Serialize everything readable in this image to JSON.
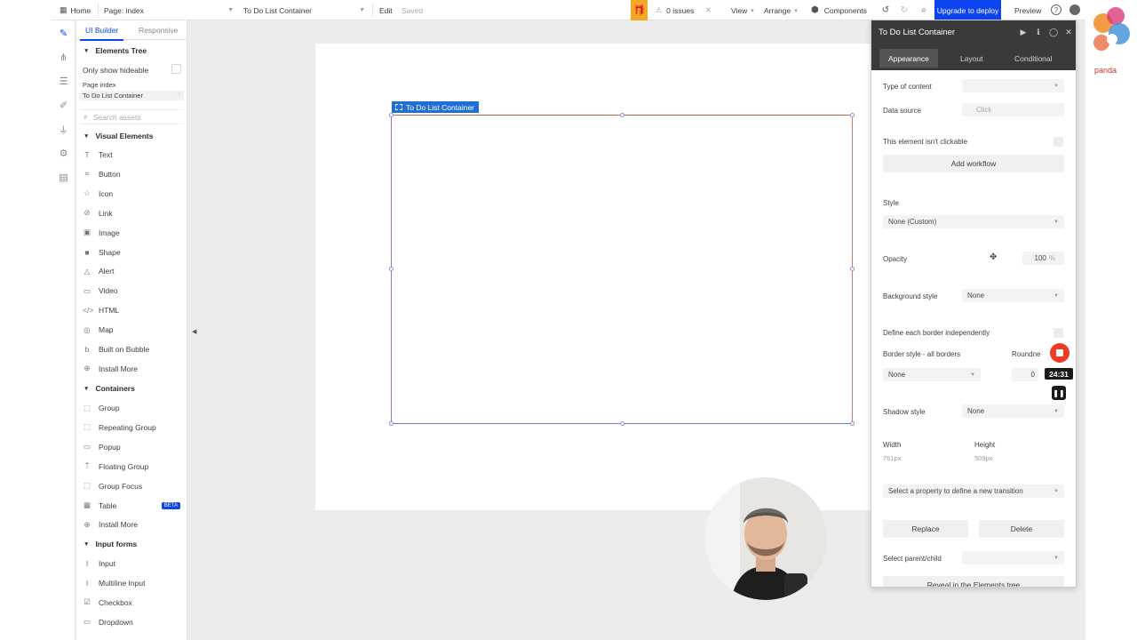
{
  "topbar": {
    "home": "Home",
    "page": "Page: index",
    "element": "To Do List Container",
    "edit": "Edit",
    "saved": "Saved",
    "issues": "0 issues",
    "view": "View",
    "arrange": "Arrange",
    "components": "Components",
    "upgrade": "Upgrade to deploy",
    "preview": "Preview"
  },
  "left_panel": {
    "tabs": [
      "UI Builder",
      "Responsive"
    ],
    "elements_tree": "Elements Tree",
    "only_show_hideable": "Only show hideable",
    "tree_items": [
      "Page index",
      "To Do List Container"
    ],
    "search_placeholder": "Search assets",
    "visual_header": "Visual Elements",
    "visual_items": [
      {
        "label": "Text",
        "icon": "T"
      },
      {
        "label": "Button",
        "icon": "⌗"
      },
      {
        "label": "Icon",
        "icon": "☆"
      },
      {
        "label": "Link",
        "icon": "⊘"
      },
      {
        "label": "Image",
        "icon": "▣"
      },
      {
        "label": "Shape",
        "icon": "■"
      },
      {
        "label": "Alert",
        "icon": "△"
      },
      {
        "label": "Video",
        "icon": "▭"
      },
      {
        "label": "HTML",
        "icon": "</>"
      },
      {
        "label": "Map",
        "icon": "◎"
      },
      {
        "label": "Built on Bubble",
        "icon": "b"
      },
      {
        "label": "Install More",
        "icon": "⊕"
      }
    ],
    "containers_header": "Containers",
    "container_items": [
      {
        "label": "Group",
        "icon": "⬚"
      },
      {
        "label": "Repeating Group",
        "icon": "⬚"
      },
      {
        "label": "Popup",
        "icon": "▭"
      },
      {
        "label": "Floating Group",
        "icon": "⍑"
      },
      {
        "label": "Group Focus",
        "icon": "⬚"
      },
      {
        "label": "Table",
        "icon": "▦"
      },
      {
        "label": "Install More",
        "icon": "⊕"
      }
    ],
    "table_badge": "BETA",
    "inputs_header": "Input forms",
    "input_items": [
      {
        "label": "Input",
        "icon": "I"
      },
      {
        "label": "Multiline Input",
        "icon": "I"
      },
      {
        "label": "Checkbox",
        "icon": "☑"
      },
      {
        "label": "Dropdown",
        "icon": "▭"
      }
    ]
  },
  "canvas": {
    "selected_label": "To Do List Container"
  },
  "property_editor": {
    "title": "To Do List Container",
    "tabs": [
      "Appearance",
      "Layout",
      "Conditional"
    ],
    "type_of_content": "Type of content",
    "data_source": "Data source",
    "data_source_value": "Click",
    "not_clickable": "This element isn't clickable",
    "add_workflow": "Add workflow",
    "style": "Style",
    "style_value": "None (Custom)",
    "opacity": "Opacity",
    "opacity_value": "100",
    "opacity_unit": "%",
    "background_style": "Background style",
    "background_value": "None",
    "define_border": "Define each border independently",
    "border_style": "Border style - all borders",
    "roundness": "Roundne",
    "border_value": "None",
    "roundness_value": "0",
    "shadow_style": "Shadow style",
    "shadow_value": "None",
    "width": "Width",
    "height": "Height",
    "width_value": "761px",
    "height_value": "509px",
    "transition": "Select a property to define a new transition",
    "replace": "Replace",
    "delete": "Delete",
    "select_parent": "Select parent/child",
    "reveal": "Reveal in the Elements tree"
  },
  "recorder": {
    "time": "24:31"
  },
  "brand": {
    "text": "panda"
  },
  "colors": {
    "accent": "#0c44f0",
    "gift": "#f5a623",
    "record": "#ef3b24",
    "selection": "#1f6fd6"
  }
}
